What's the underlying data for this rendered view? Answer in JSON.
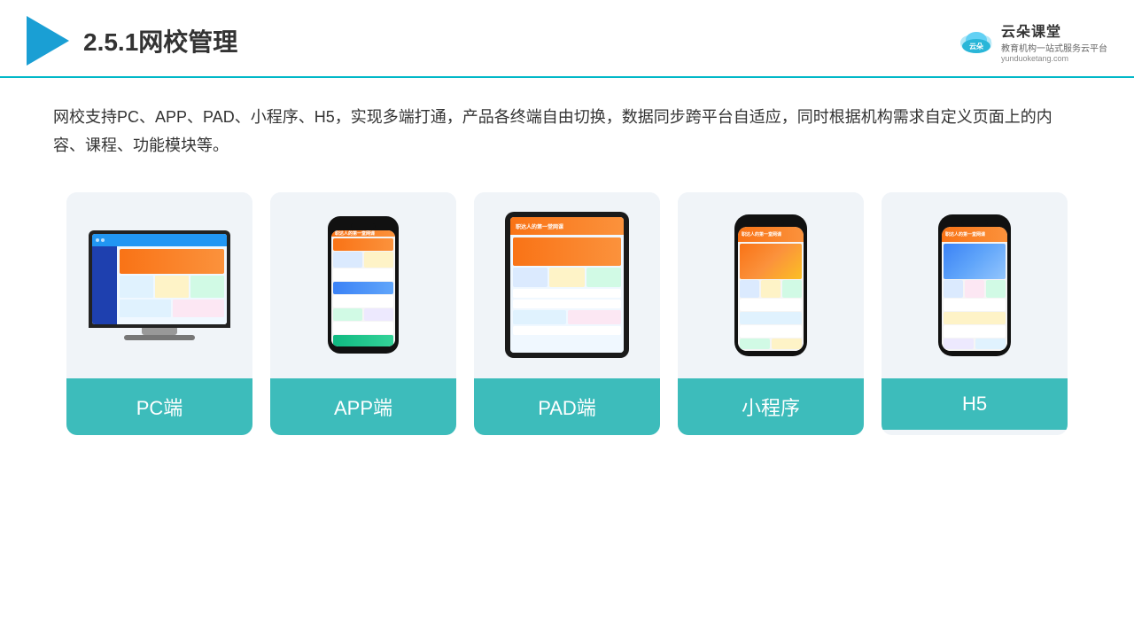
{
  "header": {
    "title": "2.5.1网校管理",
    "brand": {
      "name": "云朵课堂",
      "domain": "yunduoketang.com",
      "tagline": "教育机构一站式服务云平台"
    }
  },
  "description": "网校支持PC、APP、PAD、小程序、H5，实现多端打通，产品各终端自由切换，数据同步跨平台自适应，同时根据机构需求自定义页面上的内容、课程、功能模块等。",
  "cards": [
    {
      "id": "pc",
      "label": "PC端"
    },
    {
      "id": "app",
      "label": "APP端"
    },
    {
      "id": "pad",
      "label": "PAD端"
    },
    {
      "id": "mini",
      "label": "小程序"
    },
    {
      "id": "h5",
      "label": "H5"
    }
  ]
}
